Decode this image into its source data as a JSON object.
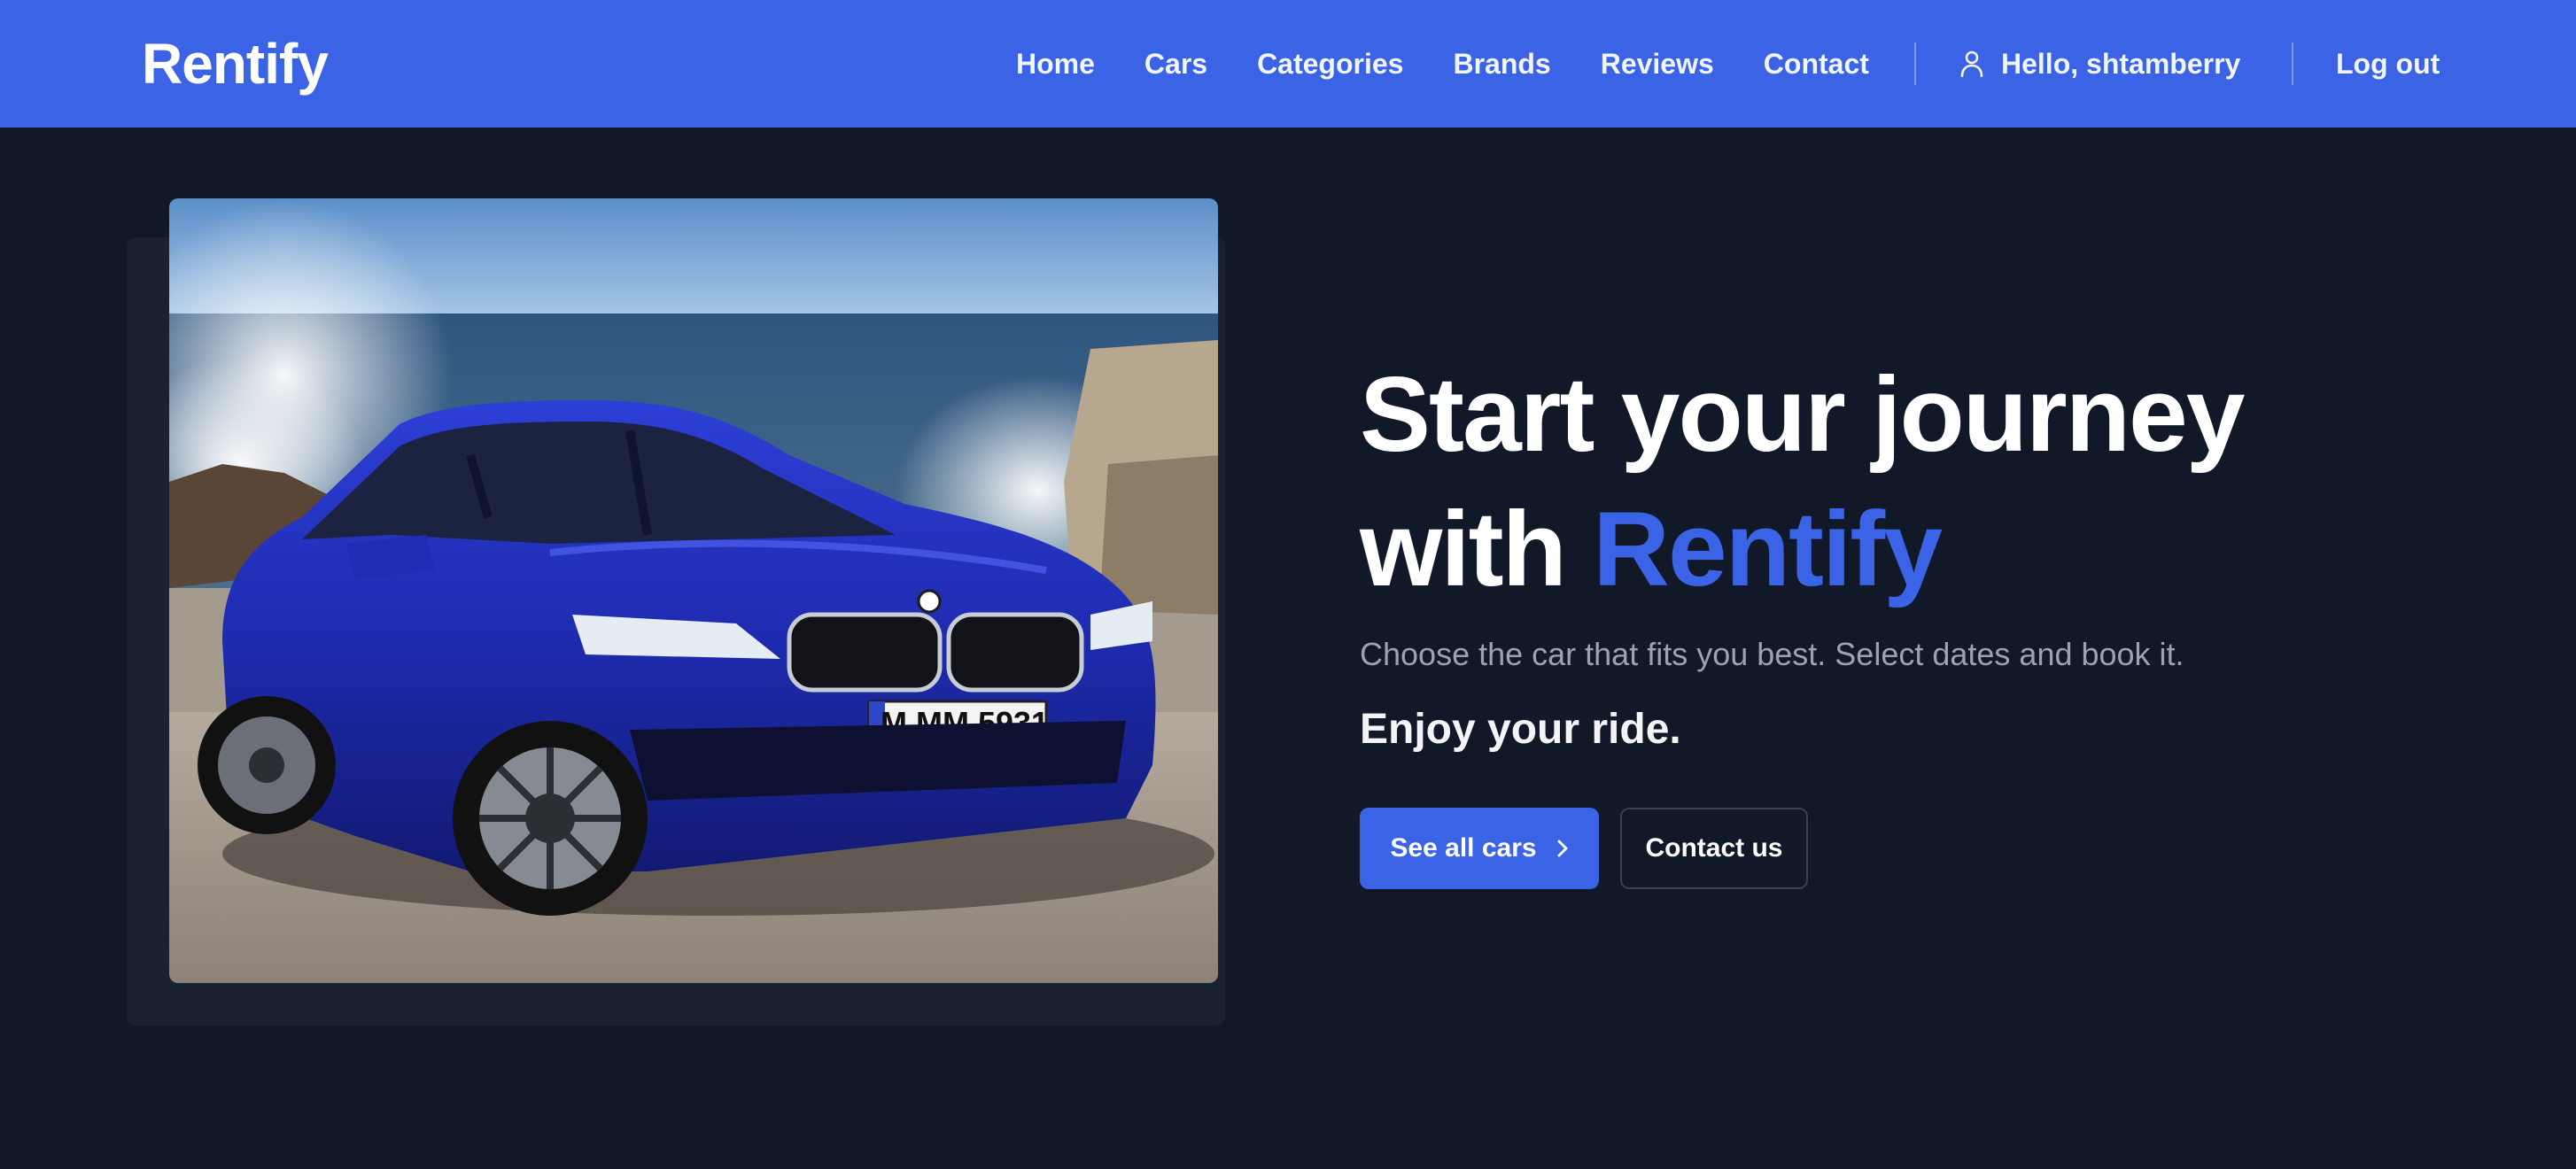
{
  "navbar": {
    "logo": "Rentify",
    "links": [
      {
        "label": "Home"
      },
      {
        "label": "Cars"
      },
      {
        "label": "Categories"
      },
      {
        "label": "Brands"
      },
      {
        "label": "Reviews"
      },
      {
        "label": "Contact"
      }
    ],
    "user_greeting": "Hello, shtamberry",
    "user_icon": "user-icon",
    "logout_label": "Log out"
  },
  "hero": {
    "image": {
      "alt_subject": "blue sedan car by the sea",
      "plate_text": "M MM 5931"
    },
    "headline_line1": "Start your journey",
    "headline_prefix": "with",
    "headline_accent": "Rentify",
    "subtitle": "Choose the car that fits you best. Select dates and book it.",
    "tagline": "Enjoy your ride.",
    "primary_button": "See all cars",
    "primary_button_icon": "chevron-right-icon",
    "secondary_button": "Contact us"
  },
  "colors": {
    "brand": "#3b63e5",
    "background": "#111827",
    "muted_text": "#9ca3af"
  }
}
